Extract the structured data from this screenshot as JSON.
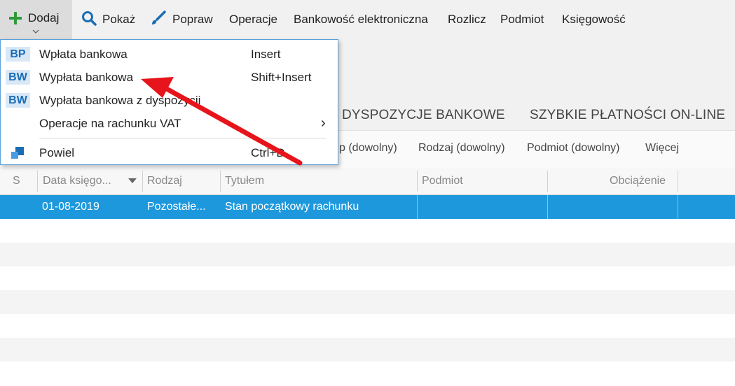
{
  "toolbar": {
    "items": [
      {
        "label": "Dodaj",
        "icon": "plus-icon"
      },
      {
        "label": "Pokaż",
        "icon": "search-icon"
      },
      {
        "label": "Popraw",
        "icon": "brush-icon"
      },
      {
        "label": "Operacje"
      },
      {
        "label": "Bankowość elektroniczna"
      },
      {
        "label": "Rozlicz"
      },
      {
        "label": "Podmiot"
      },
      {
        "label": "Księgowość"
      }
    ]
  },
  "tabs": [
    "DYSPOZYCJE BANKOWE",
    "SZYBKIE PŁATNOŚCI ON-LINE"
  ],
  "filters": [
    "p (dowolny)",
    "Rodzaj (dowolny)",
    "Podmiot (dowolny)",
    "Więcej"
  ],
  "table": {
    "headers": [
      "S",
      "Data księgo...",
      "Rodzaj",
      "Tytułem",
      "Podmiot",
      "Obciążenie"
    ],
    "rows": [
      {
        "data": "01-08-2019",
        "rodzaj": "Pozostałe...",
        "tytul": "Stan początkowy rachunku"
      }
    ]
  },
  "menu": {
    "items": [
      {
        "badge": "BP",
        "label": "Wpłata bankowa",
        "shortcut": "Insert"
      },
      {
        "badge": "BW",
        "label": "Wypłata bankowa",
        "shortcut": "Shift+Insert"
      },
      {
        "badge": "BW",
        "label": "Wypłata bankowa z dyspozycji",
        "shortcut": ""
      },
      {
        "badge": "",
        "label": "Operacje na rachunku VAT",
        "shortcut": "›"
      },
      {
        "badge": "",
        "label": "Powiel",
        "shortcut": "Ctrl+D"
      }
    ]
  },
  "colors": {
    "accent": "#1e98dc",
    "badge_bg": "#d8e8f7",
    "badge_text": "#1a6db5",
    "plus": "#2e9a3a",
    "annotation": "#e8141b"
  }
}
